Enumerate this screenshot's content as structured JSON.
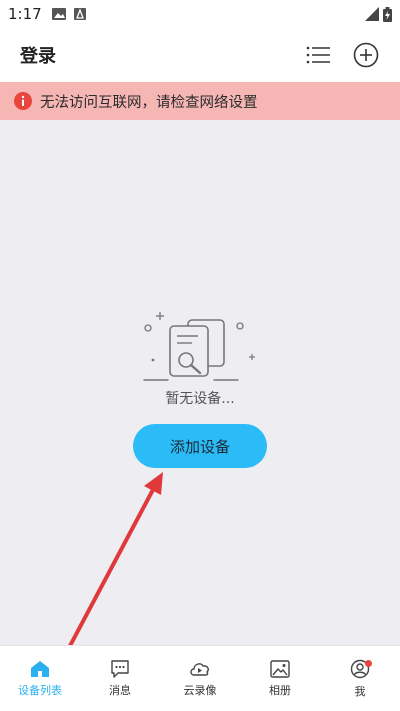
{
  "status_bar": {
    "time": "1:17"
  },
  "app_bar": {
    "title": "登录"
  },
  "banner": {
    "message": "无法访问互联网，请检查网络设置"
  },
  "empty_state": {
    "message": "暂无设备...",
    "button_label": "添加设备"
  },
  "bottom_nav": {
    "items": [
      {
        "label": "设备列表",
        "icon": "home-icon",
        "active": true
      },
      {
        "label": "消息",
        "icon": "message-icon"
      },
      {
        "label": "云录像",
        "icon": "cloud-video-icon"
      },
      {
        "label": "相册",
        "icon": "album-icon"
      },
      {
        "label": "我",
        "icon": "profile-icon",
        "badge": true
      }
    ]
  },
  "colors": {
    "accent": "#2bbcf7",
    "banner_bg": "#f6b6b4",
    "error": "#e8453c",
    "content_bg": "#eeedf2",
    "annotation_arrow": "#e0393c"
  }
}
